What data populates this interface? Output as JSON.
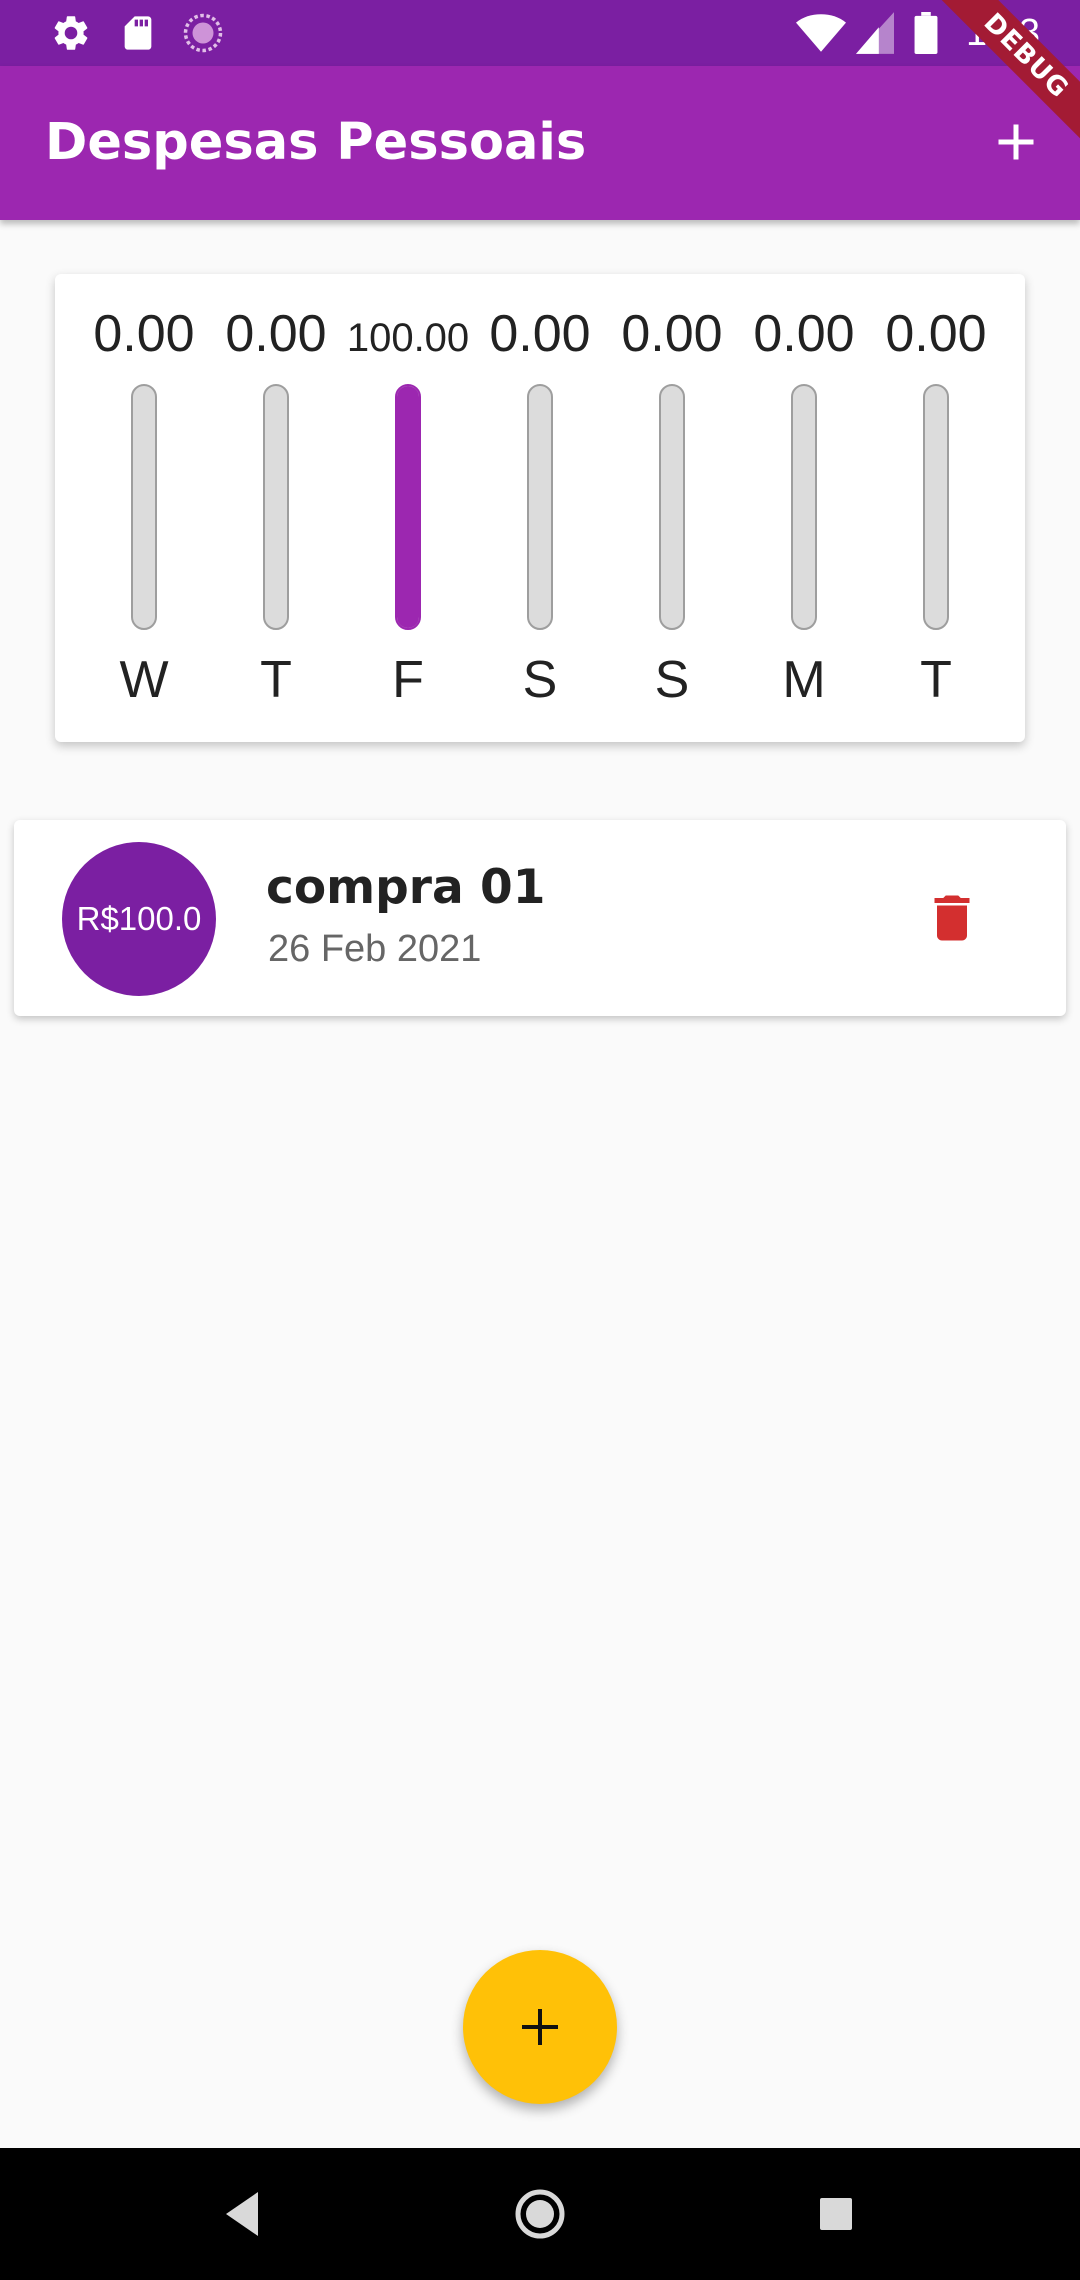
{
  "status_bar": {
    "time": "1:23",
    "icons": [
      "settings-icon",
      "sd-card-icon",
      "sync-icon",
      "wifi-icon",
      "signal-icon",
      "battery-icon"
    ]
  },
  "app_bar": {
    "title": "Despesas Pessoais",
    "add_icon": "add-icon",
    "debug_banner": "DEBUG"
  },
  "chart_data": {
    "type": "bar",
    "categories": [
      "W",
      "T",
      "F",
      "S",
      "S",
      "M",
      "T"
    ],
    "values": [
      0.0,
      0.0,
      100.0,
      0.0,
      0.0,
      0.0,
      0.0
    ],
    "value_labels": [
      "0.00",
      "0.00",
      "100.00",
      "0.00",
      "0.00",
      "0.00",
      "0.00"
    ],
    "fill_fraction": [
      0,
      0,
      1,
      0,
      0,
      0,
      0
    ],
    "colors": {
      "fill": "#9c27b0",
      "track": "#dcdcdc",
      "border": "#9e9e9e"
    }
  },
  "transactions": [
    {
      "amount": "R$100.0",
      "title": "compra 01",
      "date": "26 Feb 2021",
      "delete_icon": "trash-icon"
    }
  ],
  "fab": {
    "icon": "add-icon"
  },
  "navigation": {
    "icons": [
      "back-icon",
      "home-icon",
      "recents-icon"
    ]
  },
  "colors": {
    "primary": "#9c27b0",
    "primary_dark": "#7b1fa2",
    "accent": "#ffc107",
    "danger": "#d32f2f",
    "background": "#fafafa"
  }
}
